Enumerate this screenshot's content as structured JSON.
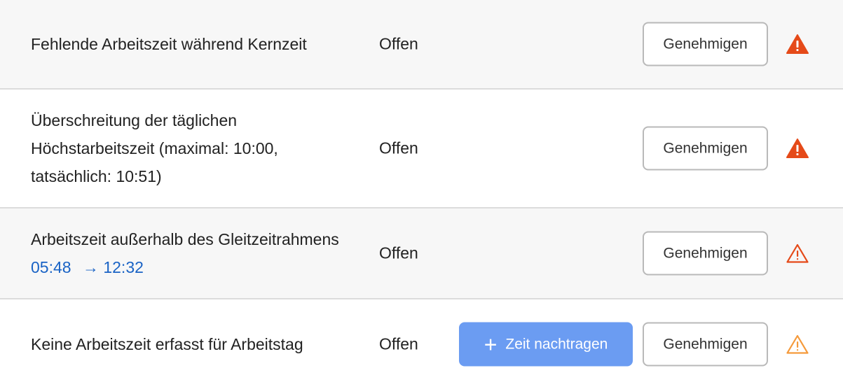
{
  "rows": [
    {
      "description": "Fehlende Arbeitszeit während Kernzeit",
      "status": "Offen",
      "approve_label": "Genehmigen",
      "warning_icon": "warning-filled-icon",
      "warning_color": "#e54a19"
    },
    {
      "description": "Überschreitung der täglichen Höchstarbeitszeit (maximal: 10:00, tatsächlich: 10:51)",
      "status": "Offen",
      "approve_label": "Genehmigen",
      "warning_icon": "warning-filled-icon",
      "warning_color": "#e54a19"
    },
    {
      "description_prefix": "Arbeitszeit außerhalb des Gleitzeitrahmens",
      "time_from": "05:48",
      "arrow": "→",
      "time_to": "12:32",
      "status": "Offen",
      "approve_label": "Genehmigen",
      "warning_icon": "warning-outline-icon",
      "warning_color": "#e54a19"
    },
    {
      "description": "Keine Arbeitszeit erfasst für Arbeitstag",
      "status": "Offen",
      "add_time_label": "Zeit nachtragen",
      "approve_label": "Genehmigen",
      "warning_icon": "warning-outline-icon",
      "warning_color": "#f59a3b"
    }
  ],
  "colors": {
    "time_link": "#1a63c5",
    "primary_button": "#6b9cf2"
  }
}
